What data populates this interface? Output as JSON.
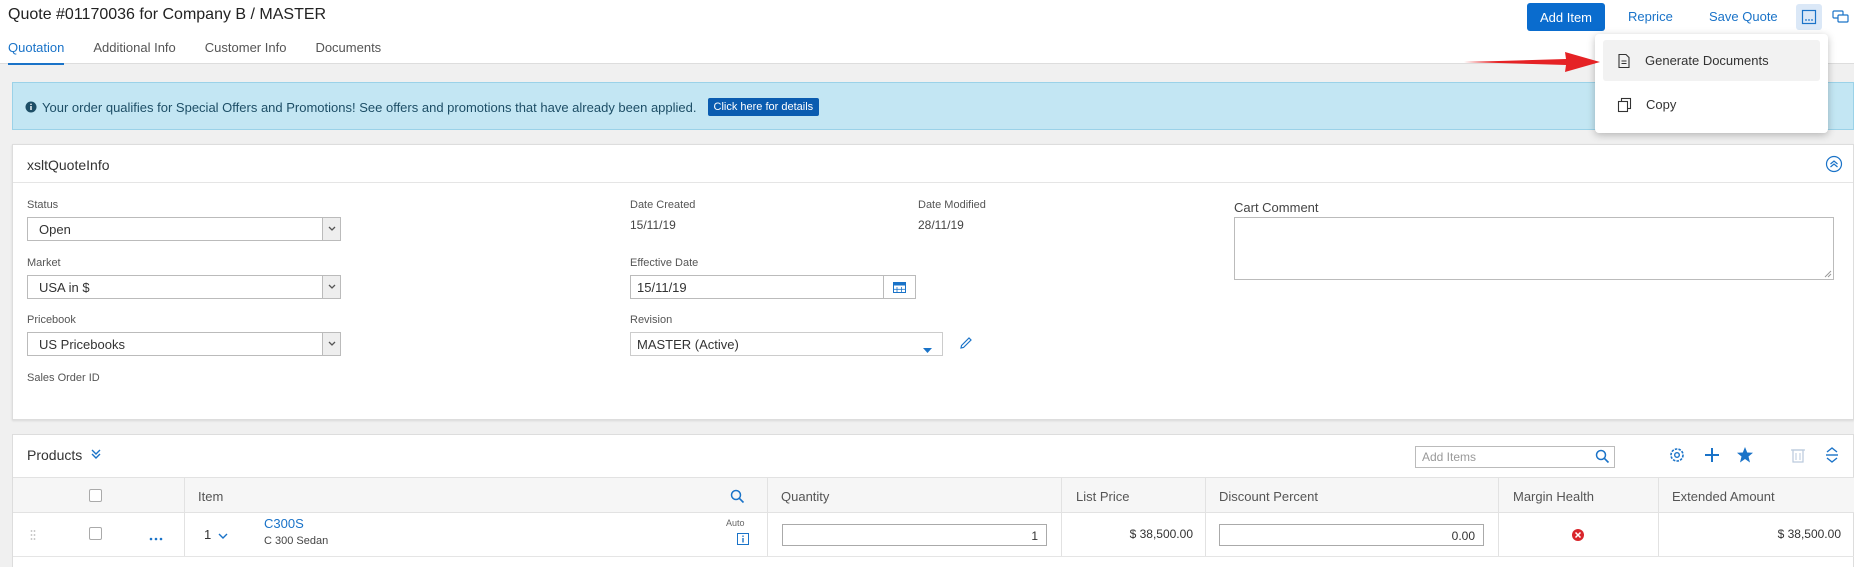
{
  "header": {
    "title": "Quote #01170036 for Company B / MASTER",
    "tabs": [
      "Quotation",
      "Additional Info",
      "Customer Info",
      "Documents"
    ],
    "add_item_label": "Add Item",
    "reprice_label": "Reprice",
    "save_quote_label": "Save Quote"
  },
  "menu": {
    "items": [
      "Generate Documents",
      "Copy"
    ]
  },
  "banner": {
    "message": "Your order qualifies for Special Offers and Promotions! See offers and promotions that have already been applied.",
    "details_label": "Click here for details"
  },
  "info_panel": {
    "title": "xsltQuoteInfo",
    "status": {
      "label": "Status",
      "value": "Open"
    },
    "market": {
      "label": "Market",
      "value": "USA in $"
    },
    "pricebook": {
      "label": "Pricebook",
      "value": "US Pricebooks"
    },
    "sales_order": {
      "label": "Sales Order ID",
      "value": ""
    },
    "date_created": {
      "label": "Date Created",
      "value": "15/11/19"
    },
    "date_modified": {
      "label": "Date Modified",
      "value": "28/11/19"
    },
    "effective_date": {
      "label": "Effective Date",
      "value": "15/11/19"
    },
    "revision": {
      "label": "Revision",
      "value": "MASTER (Active)"
    },
    "cart_comment": {
      "label": "Cart Comment",
      "value": ""
    }
  },
  "products": {
    "title": "Products",
    "search_placeholder": "Add Items",
    "columns": [
      "Item",
      "Quantity",
      "List Price",
      "Discount Percent",
      "Margin Health",
      "Extended Amount"
    ],
    "rows": [
      {
        "line": "1",
        "code": "C300S",
        "desc": "C 300 Sedan",
        "auto": "Auto",
        "quantity": "1",
        "list_price": "$ 38,500.00",
        "discount": "0.00",
        "extended": "$ 38,500.00"
      }
    ]
  },
  "colors": {
    "primary": "#0a6cce",
    "link": "#1a73c8",
    "banner_bg": "#c3e6f3",
    "error": "#d9262c"
  }
}
